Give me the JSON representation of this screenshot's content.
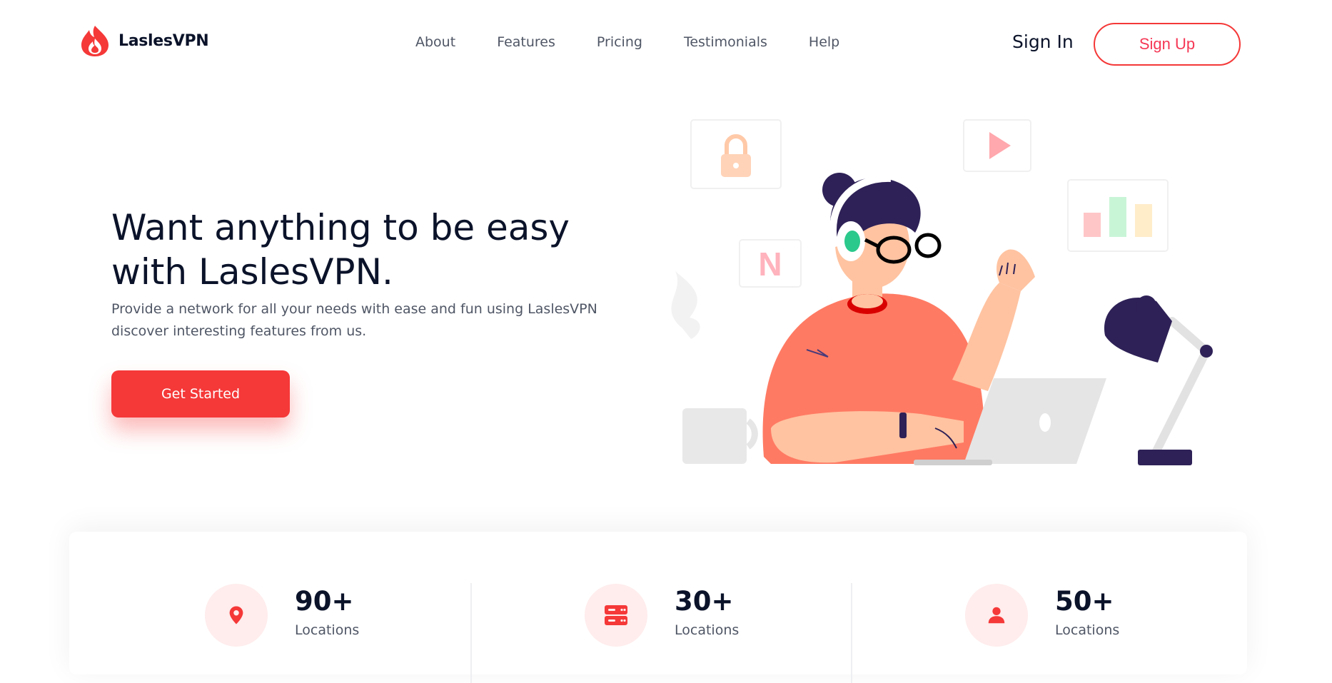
{
  "brand": {
    "name": "LaslesVPN",
    "accent": "#F53838"
  },
  "nav": {
    "items": [
      "About",
      "Features",
      "Pricing",
      "Testimonials",
      "Help"
    ],
    "sign_in": "Sign In",
    "sign_up": "Sign Up"
  },
  "hero": {
    "title": "Want anything to be easy with LaslesVPN.",
    "description": "Provide a network for all your needs with ease and fun using LaslesVPN discover interesting features from us.",
    "cta": "Get Started"
  },
  "illustration": {
    "floating_icons": [
      "lock-icon",
      "play-icon",
      "netflix-icon",
      "bar-chart-icon"
    ],
    "netflix_letter": "N"
  },
  "stats": [
    {
      "icon": "location-pin-icon",
      "value": "90+",
      "label": "Locations"
    },
    {
      "icon": "server-icon",
      "value": "30+",
      "label": "Locations"
    },
    {
      "icon": "user-icon",
      "value": "50+",
      "label": "Locations"
    }
  ]
}
